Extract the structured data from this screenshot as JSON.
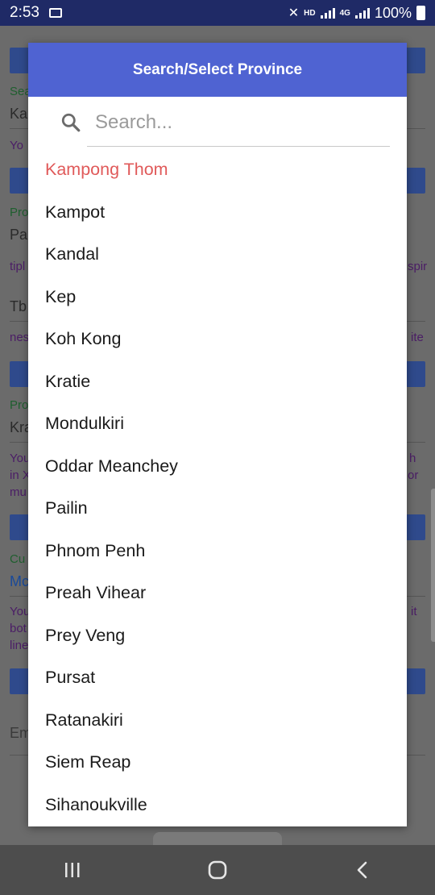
{
  "status_bar": {
    "time": "2:53",
    "hd_label": "HD",
    "network_label": "4G",
    "battery": "100%"
  },
  "background": {
    "field1_label": "Sea",
    "field1_value": "Ka",
    "field1_help": "Yo",
    "field2_label": "Pro",
    "field2_value": "Pa",
    "field2_help_left": "tipl",
    "field2_help_right": "spir",
    "field3_value": "Tb",
    "field3_help_left": "nes",
    "field3_help_right": "ite",
    "field4_label": "Pro",
    "field4_value": "Kra",
    "field4_help_left": [
      "You",
      "in X",
      "mu"
    ],
    "field4_help_right": [
      "h",
      "or"
    ],
    "field5_label": "Cu",
    "field5_value": "Mc",
    "field5_help_left": [
      "You",
      "bot",
      "line"
    ],
    "field5_help_right": [
      "it"
    ],
    "field6_placeholder": "Em"
  },
  "dialog": {
    "title": "Search/Select Province",
    "search_placeholder": "Search...",
    "items": [
      {
        "label": "Kampong Thom",
        "selected": true
      },
      {
        "label": "Kampot"
      },
      {
        "label": "Kandal"
      },
      {
        "label": "Kep"
      },
      {
        "label": "Koh Kong"
      },
      {
        "label": "Kratie"
      },
      {
        "label": "Mondulkiri"
      },
      {
        "label": "Oddar Meanchey"
      },
      {
        "label": "Pailin"
      },
      {
        "label": "Phnom Penh"
      },
      {
        "label": "Preah Vihear"
      },
      {
        "label": "Prey Veng"
      },
      {
        "label": "Pursat"
      },
      {
        "label": "Ratanakiri"
      },
      {
        "label": "Siem Reap"
      },
      {
        "label": "Sihanoukville"
      }
    ],
    "colors": {
      "header": "#4f63d2",
      "selected_text": "#e05a5a"
    }
  },
  "nav": {
    "recents_icon": "recents-icon",
    "home_icon": "home-icon",
    "back_icon": "back-icon"
  }
}
